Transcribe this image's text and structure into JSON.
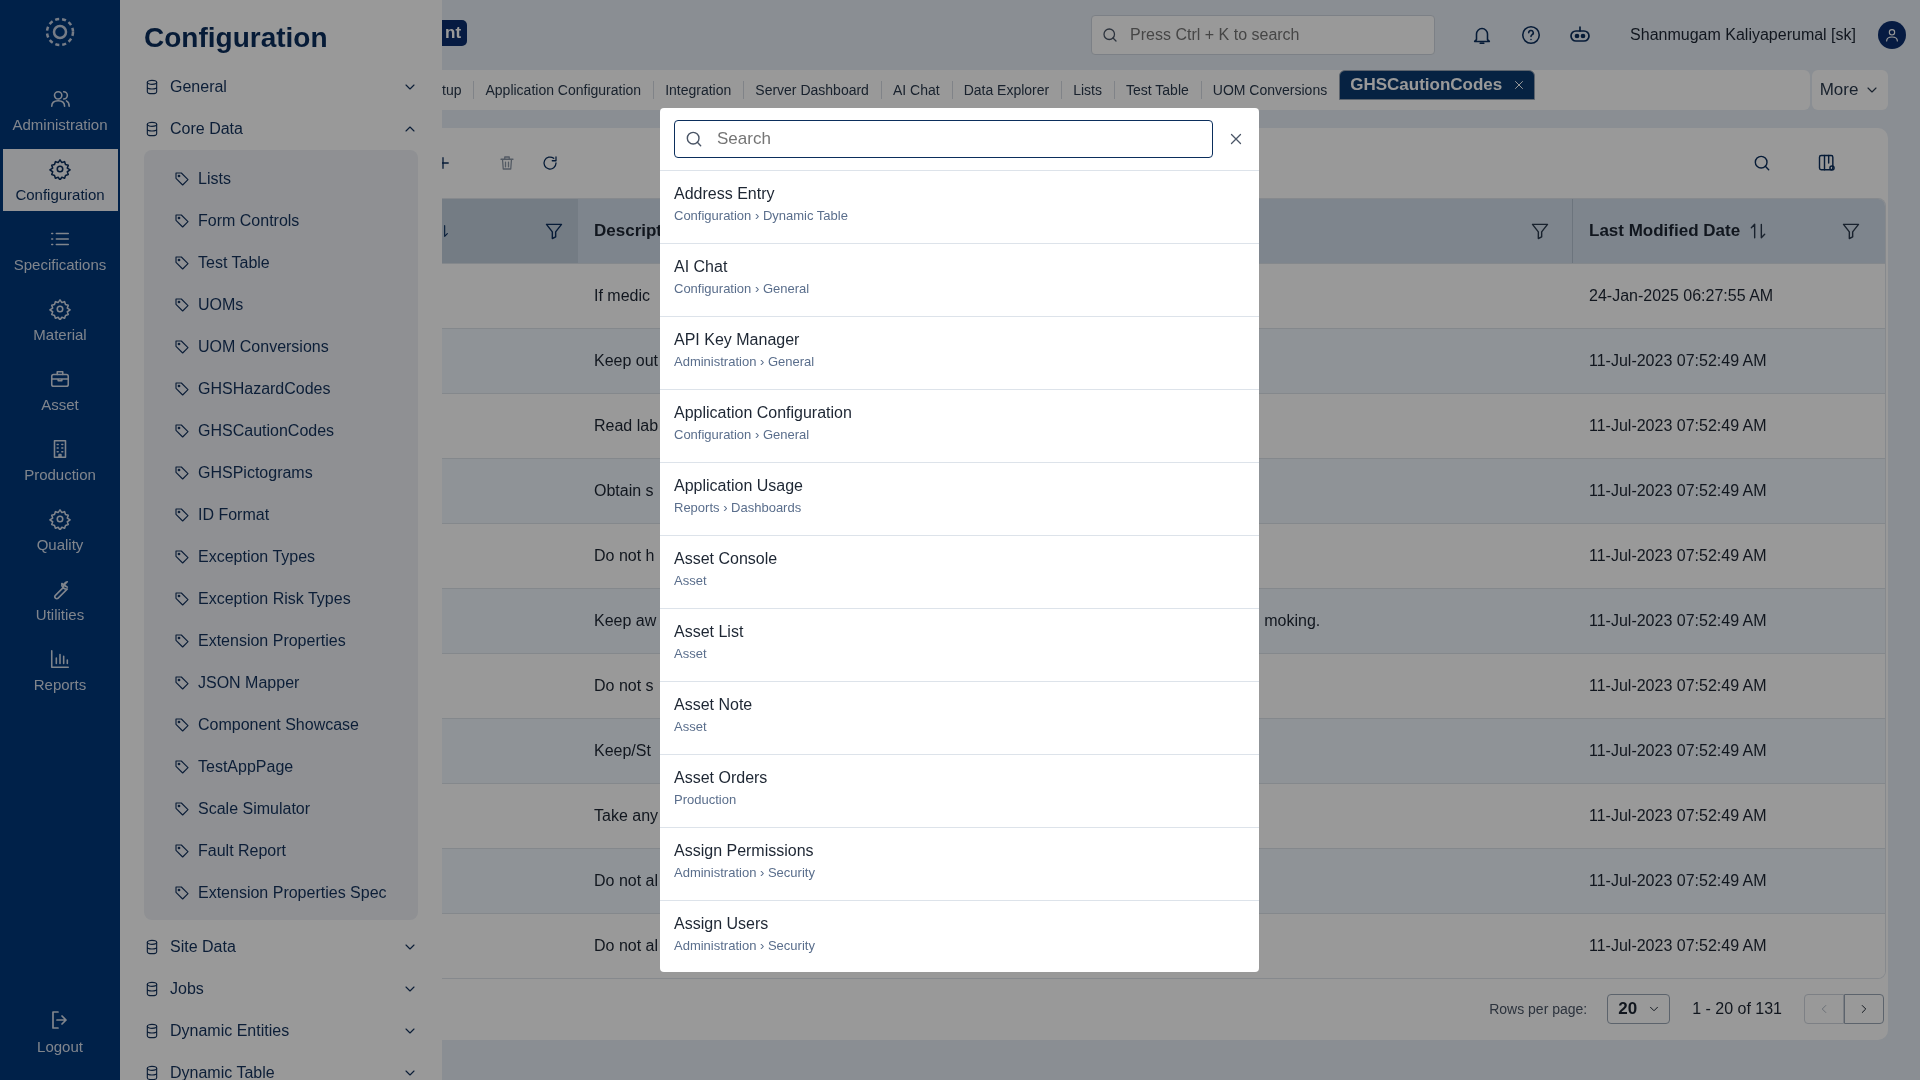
{
  "nav": {
    "items": [
      {
        "label": "Administration",
        "selected": false
      },
      {
        "label": "Configuration",
        "selected": true
      },
      {
        "label": "Specifications",
        "selected": false
      },
      {
        "label": "Material",
        "selected": false
      },
      {
        "label": "Asset",
        "selected": false
      },
      {
        "label": "Production",
        "selected": false
      },
      {
        "label": "Quality",
        "selected": false
      },
      {
        "label": "Utilities",
        "selected": false
      },
      {
        "label": "Reports",
        "selected": false
      }
    ],
    "logout": "Logout"
  },
  "config_panel": {
    "title": "Configuration",
    "sections": [
      {
        "label": "General",
        "expanded": false
      },
      {
        "label": "Core Data",
        "expanded": true,
        "children": [
          {
            "label": "Lists"
          },
          {
            "label": "Form Controls"
          },
          {
            "label": "Test Table"
          },
          {
            "label": "UOMs"
          },
          {
            "label": "UOM Conversions"
          },
          {
            "label": "GHSHazardCodes"
          },
          {
            "label": "GHSCautionCodes"
          },
          {
            "label": "GHSPictograms"
          },
          {
            "label": "ID Format"
          },
          {
            "label": "Exception Types"
          },
          {
            "label": "Exception Risk Types"
          },
          {
            "label": "Extension Properties"
          },
          {
            "label": "JSON Mapper"
          },
          {
            "label": "Component Showcase"
          },
          {
            "label": "TestAppPage"
          },
          {
            "label": "Scale Simulator"
          },
          {
            "label": "Fault Report"
          },
          {
            "label": "Extension Properties Spec"
          }
        ]
      },
      {
        "label": "Site Data",
        "expanded": false
      },
      {
        "label": "Jobs",
        "expanded": false
      },
      {
        "label": "Dynamic Entities",
        "expanded": false
      },
      {
        "label": "Dynamic Table",
        "expanded": false
      }
    ]
  },
  "header": {
    "app_badge": "nt",
    "search": {
      "placeholder": "Press Ctrl + K to search"
    },
    "user": "Shanmugam Kaliyaperumal [sk]"
  },
  "tabs": [
    {
      "label": "tup",
      "selected": false
    },
    {
      "label": "Application Configuration",
      "selected": false
    },
    {
      "label": "Integration",
      "selected": false
    },
    {
      "label": "Server Dashboard",
      "selected": false
    },
    {
      "label": "AI Chat",
      "selected": false
    },
    {
      "label": "Data Explorer",
      "selected": false
    },
    {
      "label": "Lists",
      "selected": false
    },
    {
      "label": "Test Table",
      "selected": false
    },
    {
      "label": "UOM Conversions",
      "selected": false
    },
    {
      "label": "GHSCautionCodes",
      "selected": true
    }
  ],
  "more": "More",
  "table": {
    "columns": [
      "Descript",
      "Last Modified Date"
    ],
    "rows": [
      {
        "description": "If medic",
        "date": "24-Jan-2025 06:27:55 AM"
      },
      {
        "description": "Keep out",
        "date": "11-Jul-2023 07:52:49 AM"
      },
      {
        "description": "Read lab",
        "date": "11-Jul-2023 07:52:49 AM"
      },
      {
        "description": "Obtain s",
        "date": "11-Jul-2023 07:52:49 AM"
      },
      {
        "description": "Do not h",
        "date": "11-Jul-2023 07:52:49 AM"
      },
      {
        "description": "Keep aw",
        "description_tail": "moking.",
        "date": "11-Jul-2023 07:52:49 AM"
      },
      {
        "description": "Do not s",
        "date": "11-Jul-2023 07:52:49 AM"
      },
      {
        "description": "Keep/St",
        "date": "11-Jul-2023 07:52:49 AM"
      },
      {
        "description": "Take any",
        "date": "11-Jul-2023 07:52:49 AM"
      },
      {
        "description": "Do not al",
        "date": "11-Jul-2023 07:52:49 AM"
      },
      {
        "description": "Do not al",
        "date": "11-Jul-2023 07:52:49 AM"
      }
    ]
  },
  "pagination": {
    "label": "Rows per page:",
    "rows_per_page": "20",
    "range": "1 - 20 of 131"
  },
  "search_dialog": {
    "placeholder": "Search",
    "results": [
      {
        "title": "Address Entry",
        "path": "Configuration › Dynamic Table"
      },
      {
        "title": "AI Chat",
        "path": "Configuration › General"
      },
      {
        "title": "API Key Manager",
        "path": "Administration › General"
      },
      {
        "title": "Application Configuration",
        "path": "Configuration › General"
      },
      {
        "title": "Application Usage",
        "path": "Reports › Dashboards"
      },
      {
        "title": "Asset Console",
        "path": "Asset"
      },
      {
        "title": "Asset List",
        "path": "Asset"
      },
      {
        "title": "Asset Note",
        "path": "Asset"
      },
      {
        "title": "Asset Orders",
        "path": "Production"
      },
      {
        "title": "Assign Permissions",
        "path": "Administration › Security"
      },
      {
        "title": "Assign Users",
        "path": "Administration › Security"
      }
    ]
  }
}
